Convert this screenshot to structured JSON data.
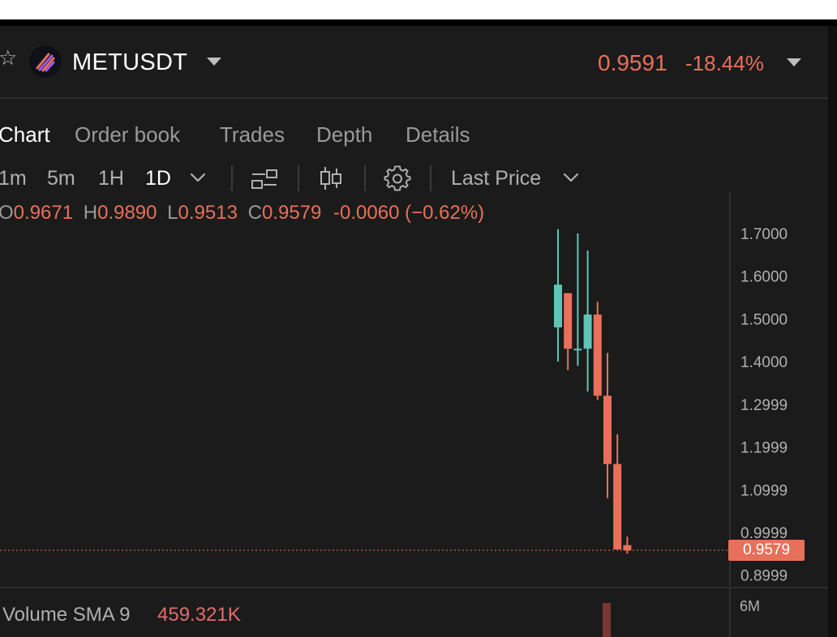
{
  "header": {
    "symbol": "METUSDT",
    "price": "0.9591",
    "change_pct": "-18.44%"
  },
  "tabs": [
    {
      "label": "Chart",
      "active": true
    },
    {
      "label": "Order book",
      "active": false
    },
    {
      "label": "Trades",
      "active": false
    },
    {
      "label": "Depth",
      "active": false
    },
    {
      "label": "Details",
      "active": false
    }
  ],
  "toolbar": {
    "timeframes": [
      {
        "label": "1m",
        "active": false
      },
      {
        "label": "5m",
        "active": false
      },
      {
        "label": "1H",
        "active": false
      },
      {
        "label": "1D",
        "active": true
      }
    ],
    "price_type": "Last Price",
    "icons": [
      "indicator-icon",
      "candle-type-icon",
      "settings-icon"
    ]
  },
  "ohlc": {
    "o_key": "O",
    "o": "0.9671",
    "h_key": "H",
    "h": "0.9890",
    "l_key": "L",
    "l": "0.9513",
    "c_key": "C",
    "c": "0.9579",
    "change": "-0.0060 (−0.62%)"
  },
  "colors": {
    "up": "#5ec4b6",
    "down": "#e8705a",
    "volume_bar": "#7a3535",
    "background": "#1b1b1b"
  },
  "volume": {
    "label": "Volume SMA 9",
    "value": "459.321K",
    "axis_label": "6M"
  },
  "last_price_tag": "0.9579",
  "chart_data": {
    "type": "candlestick",
    "y_axis_ticks": [
      "1.7000",
      "1.6000",
      "1.5000",
      "1.4000",
      "1.2999",
      "1.1999",
      "1.0999",
      "0.9999",
      "0.8999"
    ],
    "candles": [
      {
        "o": 1.48,
        "h": 1.71,
        "l": 1.4,
        "c": 1.58
      },
      {
        "o": 1.56,
        "h": 1.54,
        "l": 1.38,
        "c": 1.43
      },
      {
        "o": 1.43,
        "h": 1.7,
        "l": 1.39,
        "c": 1.43
      },
      {
        "o": 1.43,
        "h": 1.66,
        "l": 1.33,
        "c": 1.51
      },
      {
        "o": 1.51,
        "h": 1.54,
        "l": 1.31,
        "c": 1.32
      },
      {
        "o": 1.32,
        "h": 1.42,
        "l": 1.08,
        "c": 1.16
      },
      {
        "o": 1.16,
        "h": 1.23,
        "l": 0.98,
        "c": 0.96
      },
      {
        "o": 0.97,
        "h": 0.99,
        "l": 0.95,
        "c": 0.9579
      }
    ]
  }
}
